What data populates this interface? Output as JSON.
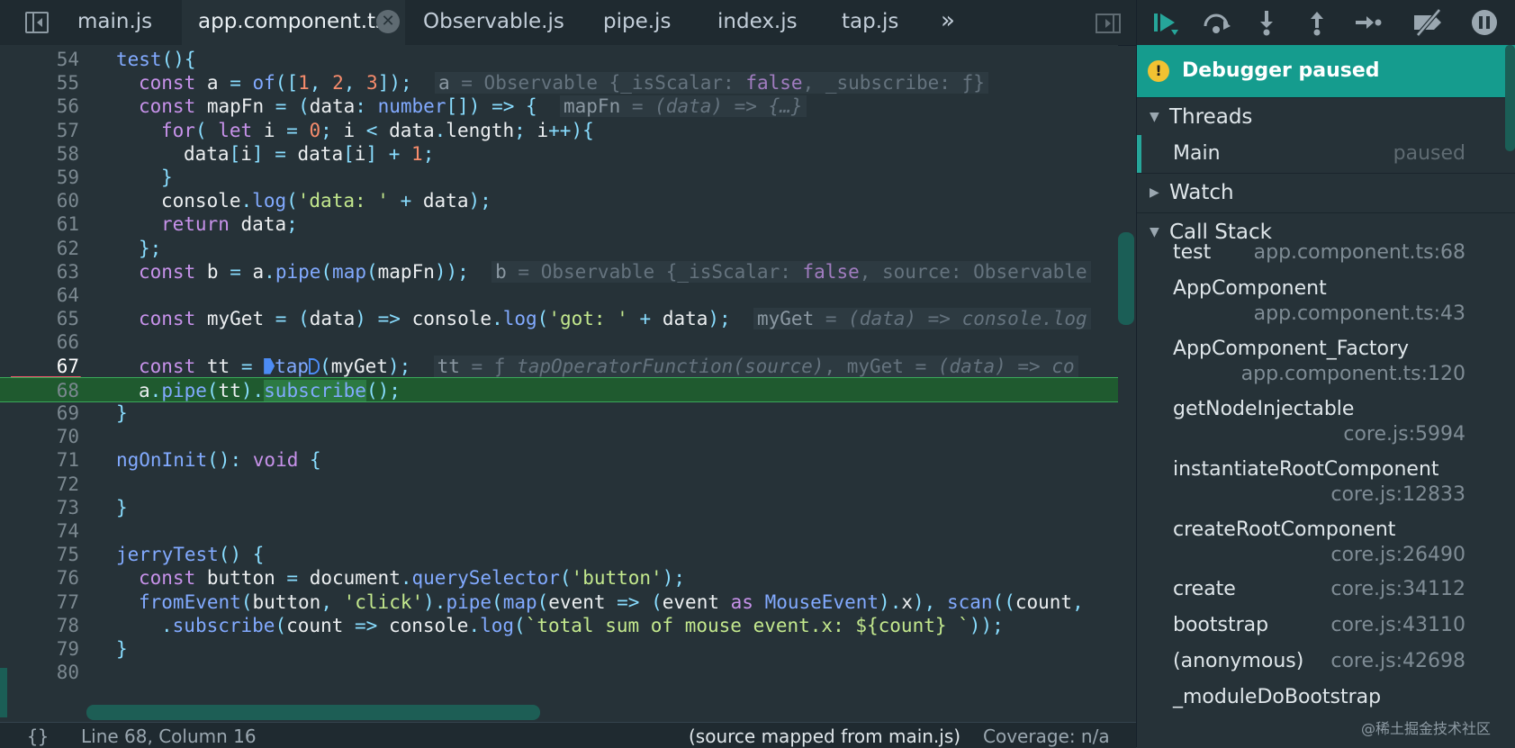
{
  "tabs": [
    {
      "label": "main.js",
      "active": false
    },
    {
      "label": "app.component.ts",
      "active": true
    },
    {
      "label": "Observable.js",
      "active": false
    },
    {
      "label": "pipe.js",
      "active": false
    },
    {
      "label": "index.js",
      "active": false
    },
    {
      "label": "tap.js",
      "active": false
    }
  ],
  "tab_close_glyph": "✕",
  "more_tabs_glyph": "»",
  "editor": {
    "breakpoint_line": "67",
    "current_line": "68",
    "lines": [
      {
        "num": "54",
        "code": "test(){"
      },
      {
        "num": "55",
        "code": "const a = of([1, 2, 3]);",
        "inline": "a = Observable {_isScalar: false, _subscribe: ƒ}"
      },
      {
        "num": "56",
        "code": "const mapFn = (data: number[]) => {",
        "inline": "mapFn = (data) => {…}"
      },
      {
        "num": "57",
        "code": "for( let i = 0; i < data.length; i++){"
      },
      {
        "num": "58",
        "code": "data[i] = data[i] + 1;"
      },
      {
        "num": "59",
        "code": "}"
      },
      {
        "num": "60",
        "code": "console.log('data: ' + data);"
      },
      {
        "num": "61",
        "code": "return data;"
      },
      {
        "num": "62",
        "code": "};"
      },
      {
        "num": "63",
        "code": "const b = a.pipe(map(mapFn));",
        "inline": "b = Observable {_isScalar: false, source: Observable"
      },
      {
        "num": "64",
        "code": ""
      },
      {
        "num": "65",
        "code": "const myGet = (data) => console.log('got: ' + data);",
        "inline": "myGet = (data) => console.log"
      },
      {
        "num": "66",
        "code": ""
      },
      {
        "num": "67",
        "code": "const tt = tap(myGet);",
        "inline": "tt = ƒ tapOperatorFunction(source), myGet = (data) => co"
      },
      {
        "num": "68",
        "code": "a.pipe(tt).subscribe();"
      },
      {
        "num": "69",
        "code": "}"
      },
      {
        "num": "70",
        "code": ""
      },
      {
        "num": "71",
        "code": "ngOnInit(): void {"
      },
      {
        "num": "72",
        "code": ""
      },
      {
        "num": "73",
        "code": "}"
      },
      {
        "num": "74",
        "code": ""
      },
      {
        "num": "75",
        "code": "jerryTest() {"
      },
      {
        "num": "76",
        "code": "const button = document.querySelector('button');"
      },
      {
        "num": "77",
        "code": "fromEvent(button, 'click').pipe(map(event => (event as MouseEvent).x), scan((count,"
      },
      {
        "num": "78",
        "code": ".subscribe(count => console.log(`total sum of mouse event.x: ${count} `));"
      },
      {
        "num": "79",
        "code": "}"
      },
      {
        "num": "80",
        "code": ""
      }
    ]
  },
  "statusbar": {
    "braces": "{}",
    "position": "Line 68, Column 16",
    "source_mapped": "(source mapped from main.js)",
    "coverage": "Coverage: n/a"
  },
  "debugger": {
    "banner": "Debugger paused",
    "info_glyph": "!",
    "threads_label": "Threads",
    "thread": {
      "name": "Main",
      "status": "paused"
    },
    "watch_label": "Watch",
    "callstack_label": "Call Stack",
    "frames": [
      {
        "fn": "test",
        "loc": "app.component.ts:68"
      },
      {
        "fn": "AppComponent",
        "loc": "app.component.ts:43"
      },
      {
        "fn": "AppComponent_Factory",
        "loc": "app.component.ts:120"
      },
      {
        "fn": "getNodeInjectable",
        "loc": "core.js:5994"
      },
      {
        "fn": "instantiateRootComponent",
        "loc": "core.js:12833"
      },
      {
        "fn": "createRootComponent",
        "loc": "core.js:26490"
      },
      {
        "fn": "create",
        "loc": "core.js:34112"
      },
      {
        "fn": "bootstrap",
        "loc": "core.js:43110"
      },
      {
        "fn": "(anonymous)",
        "loc": "core.js:42698"
      },
      {
        "fn": "_moduleDoBootstrap",
        "loc": ""
      }
    ],
    "toolbar_icons": [
      "resume-icon",
      "step-over-icon",
      "step-into-icon",
      "step-out-icon",
      "step-icon",
      "deactivate-breakpoints-icon",
      "pause-on-exceptions-icon"
    ]
  },
  "watermark": "@稀土掘金技术社区",
  "colors": {
    "accent": "#159c8e",
    "breakpoint": "#f0566b",
    "current_line": "#1f5a2f"
  }
}
